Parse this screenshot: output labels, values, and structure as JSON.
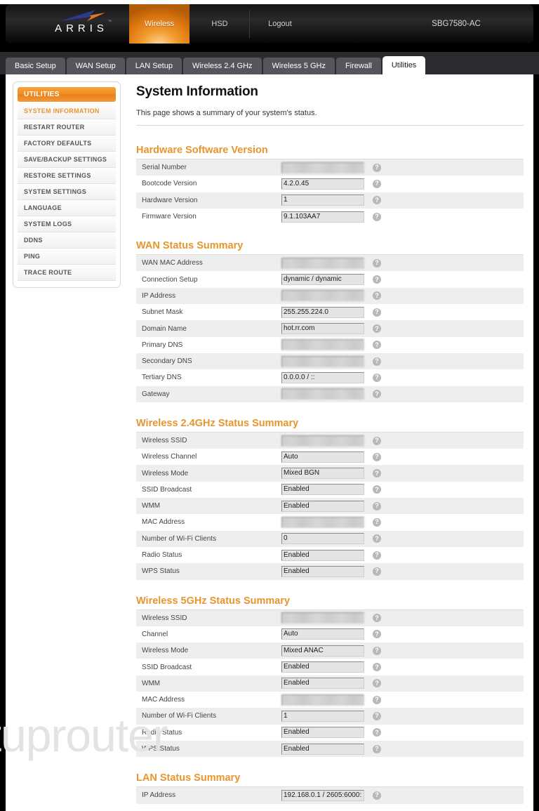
{
  "header": {
    "brand": "ARRIS",
    "trademark": "™",
    "nav": [
      {
        "label": "Wireless",
        "active": true
      },
      {
        "label": "HSD",
        "active": false
      },
      {
        "label": "Logout",
        "active": false
      }
    ],
    "model": "SBG7580-AC"
  },
  "tabs": [
    {
      "label": "Basic Setup",
      "active": false
    },
    {
      "label": "WAN Setup",
      "active": false
    },
    {
      "label": "LAN Setup",
      "active": false
    },
    {
      "label": "Wireless 2.4 GHz",
      "active": false
    },
    {
      "label": "Wireless 5 GHz",
      "active": false
    },
    {
      "label": "Firewall",
      "active": false
    },
    {
      "label": "Utilities",
      "active": true
    }
  ],
  "sidebar": {
    "header": "UTILITIES",
    "items": [
      {
        "label": "SYSTEM INFORMATION",
        "active": true
      },
      {
        "label": "RESTART ROUTER",
        "active": false
      },
      {
        "label": "FACTORY DEFAULTS",
        "active": false
      },
      {
        "label": "SAVE/BACKUP SETTINGS",
        "active": false
      },
      {
        "label": "RESTORE SETTINGS",
        "active": false
      },
      {
        "label": "SYSTEM SETTINGS",
        "active": false
      },
      {
        "label": "LANGUAGE",
        "active": false
      },
      {
        "label": "SYSTEM LOGS",
        "active": false
      },
      {
        "label": "DDNS",
        "active": false
      },
      {
        "label": "PING",
        "active": false
      },
      {
        "label": "TRACE ROUTE",
        "active": false
      }
    ]
  },
  "main": {
    "title": "System Information",
    "description": "This page shows a summary of your system's status.",
    "help_glyph": "?",
    "watermark": "setuprouter",
    "sections": [
      {
        "heading": "Hardware Software Version",
        "rows": [
          {
            "label": "Serial Number",
            "value": "",
            "redacted": true
          },
          {
            "label": "Bootcode Version",
            "value": "4.2.0.45",
            "redacted": false
          },
          {
            "label": "Hardware Version",
            "value": "1",
            "redacted": false
          },
          {
            "label": "Firmware Version",
            "value": "9.1.103AA7",
            "redacted": false
          }
        ]
      },
      {
        "heading": "WAN Status Summary",
        "rows": [
          {
            "label": "WAN MAC Address",
            "value": "",
            "redacted": true
          },
          {
            "label": "Connection Setup",
            "value": "dynamic / dynamic",
            "redacted": false
          },
          {
            "label": "IP Address",
            "value": "",
            "redacted": true
          },
          {
            "label": "Subnet Mask",
            "value": "255.255.224.0",
            "redacted": false
          },
          {
            "label": "Domain Name",
            "value": "hot.rr.com",
            "redacted": false
          },
          {
            "label": "Primary DNS",
            "value": "",
            "redacted": true
          },
          {
            "label": "Secondary DNS",
            "value": "",
            "redacted": true
          },
          {
            "label": "Tertiary DNS",
            "value": "0.0.0.0 / ::",
            "redacted": false
          },
          {
            "label": "Gateway",
            "value": "",
            "redacted": true
          }
        ]
      },
      {
        "heading": "Wireless 2.4GHz Status Summary",
        "rows": [
          {
            "label": "Wireless SSID",
            "value": "",
            "redacted": true
          },
          {
            "label": "Wireless Channel",
            "value": "Auto",
            "redacted": false
          },
          {
            "label": "Wireless Mode",
            "value": "Mixed BGN",
            "redacted": false
          },
          {
            "label": "SSID Broadcast",
            "value": "Enabled",
            "redacted": false
          },
          {
            "label": "WMM",
            "value": "Enabled",
            "redacted": false
          },
          {
            "label": "MAC Address",
            "value": "",
            "redacted": true
          },
          {
            "label": "Number of Wi-Fi Clients",
            "value": "0",
            "redacted": false
          },
          {
            "label": "Radio Status",
            "value": "Enabled",
            "redacted": false
          },
          {
            "label": "WPS Status",
            "value": "Enabled",
            "redacted": false
          }
        ]
      },
      {
        "heading": "Wireless 5GHz Status Summary",
        "rows": [
          {
            "label": "Wireless SSID",
            "value": "",
            "redacted": true
          },
          {
            "label": "Channel",
            "value": "Auto",
            "redacted": false
          },
          {
            "label": "Wireless Mode",
            "value": "Mixed ANAC",
            "redacted": false
          },
          {
            "label": "SSID Broadcast",
            "value": "Enabled",
            "redacted": false
          },
          {
            "label": "WMM",
            "value": "Enabled",
            "redacted": false
          },
          {
            "label": "MAC Address",
            "value": "",
            "redacted": true
          },
          {
            "label": "Number of Wi-Fi Clients",
            "value": "1",
            "redacted": false
          },
          {
            "label": "Radio Status",
            "value": "Enabled",
            "redacted": false
          },
          {
            "label": "WPS Status",
            "value": "Enabled",
            "redacted": false
          }
        ]
      },
      {
        "heading": "LAN Status Summary",
        "rows": [
          {
            "label": "IP Address",
            "value": "192.168.0.1 / 2605:6000:",
            "redacted": false
          }
        ]
      }
    ]
  },
  "colors": {
    "accent_orange": "#e8952e",
    "header_black": "#000000",
    "tab_grey": "#55555c",
    "row_alt": "#eeeeee"
  }
}
